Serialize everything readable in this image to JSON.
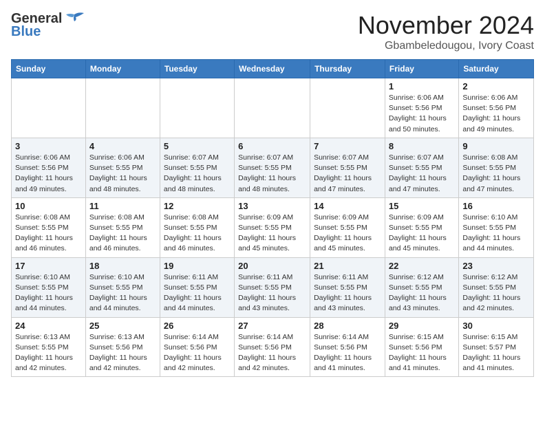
{
  "header": {
    "logo_line1": "General",
    "logo_line2": "Blue",
    "month": "November 2024",
    "location": "Gbambeledougou, Ivory Coast"
  },
  "weekdays": [
    "Sunday",
    "Monday",
    "Tuesday",
    "Wednesday",
    "Thursday",
    "Friday",
    "Saturday"
  ],
  "weeks": [
    [
      {
        "day": "",
        "info": ""
      },
      {
        "day": "",
        "info": ""
      },
      {
        "day": "",
        "info": ""
      },
      {
        "day": "",
        "info": ""
      },
      {
        "day": "",
        "info": ""
      },
      {
        "day": "1",
        "info": "Sunrise: 6:06 AM\nSunset: 5:56 PM\nDaylight: 11 hours\nand 50 minutes."
      },
      {
        "day": "2",
        "info": "Sunrise: 6:06 AM\nSunset: 5:56 PM\nDaylight: 11 hours\nand 49 minutes."
      }
    ],
    [
      {
        "day": "3",
        "info": "Sunrise: 6:06 AM\nSunset: 5:56 PM\nDaylight: 11 hours\nand 49 minutes."
      },
      {
        "day": "4",
        "info": "Sunrise: 6:06 AM\nSunset: 5:55 PM\nDaylight: 11 hours\nand 48 minutes."
      },
      {
        "day": "5",
        "info": "Sunrise: 6:07 AM\nSunset: 5:55 PM\nDaylight: 11 hours\nand 48 minutes."
      },
      {
        "day": "6",
        "info": "Sunrise: 6:07 AM\nSunset: 5:55 PM\nDaylight: 11 hours\nand 48 minutes."
      },
      {
        "day": "7",
        "info": "Sunrise: 6:07 AM\nSunset: 5:55 PM\nDaylight: 11 hours\nand 47 minutes."
      },
      {
        "day": "8",
        "info": "Sunrise: 6:07 AM\nSunset: 5:55 PM\nDaylight: 11 hours\nand 47 minutes."
      },
      {
        "day": "9",
        "info": "Sunrise: 6:08 AM\nSunset: 5:55 PM\nDaylight: 11 hours\nand 47 minutes."
      }
    ],
    [
      {
        "day": "10",
        "info": "Sunrise: 6:08 AM\nSunset: 5:55 PM\nDaylight: 11 hours\nand 46 minutes."
      },
      {
        "day": "11",
        "info": "Sunrise: 6:08 AM\nSunset: 5:55 PM\nDaylight: 11 hours\nand 46 minutes."
      },
      {
        "day": "12",
        "info": "Sunrise: 6:08 AM\nSunset: 5:55 PM\nDaylight: 11 hours\nand 46 minutes."
      },
      {
        "day": "13",
        "info": "Sunrise: 6:09 AM\nSunset: 5:55 PM\nDaylight: 11 hours\nand 45 minutes."
      },
      {
        "day": "14",
        "info": "Sunrise: 6:09 AM\nSunset: 5:55 PM\nDaylight: 11 hours\nand 45 minutes."
      },
      {
        "day": "15",
        "info": "Sunrise: 6:09 AM\nSunset: 5:55 PM\nDaylight: 11 hours\nand 45 minutes."
      },
      {
        "day": "16",
        "info": "Sunrise: 6:10 AM\nSunset: 5:55 PM\nDaylight: 11 hours\nand 44 minutes."
      }
    ],
    [
      {
        "day": "17",
        "info": "Sunrise: 6:10 AM\nSunset: 5:55 PM\nDaylight: 11 hours\nand 44 minutes."
      },
      {
        "day": "18",
        "info": "Sunrise: 6:10 AM\nSunset: 5:55 PM\nDaylight: 11 hours\nand 44 minutes."
      },
      {
        "day": "19",
        "info": "Sunrise: 6:11 AM\nSunset: 5:55 PM\nDaylight: 11 hours\nand 44 minutes."
      },
      {
        "day": "20",
        "info": "Sunrise: 6:11 AM\nSunset: 5:55 PM\nDaylight: 11 hours\nand 43 minutes."
      },
      {
        "day": "21",
        "info": "Sunrise: 6:11 AM\nSunset: 5:55 PM\nDaylight: 11 hours\nand 43 minutes."
      },
      {
        "day": "22",
        "info": "Sunrise: 6:12 AM\nSunset: 5:55 PM\nDaylight: 11 hours\nand 43 minutes."
      },
      {
        "day": "23",
        "info": "Sunrise: 6:12 AM\nSunset: 5:55 PM\nDaylight: 11 hours\nand 42 minutes."
      }
    ],
    [
      {
        "day": "24",
        "info": "Sunrise: 6:13 AM\nSunset: 5:55 PM\nDaylight: 11 hours\nand 42 minutes."
      },
      {
        "day": "25",
        "info": "Sunrise: 6:13 AM\nSunset: 5:56 PM\nDaylight: 11 hours\nand 42 minutes."
      },
      {
        "day": "26",
        "info": "Sunrise: 6:14 AM\nSunset: 5:56 PM\nDaylight: 11 hours\nand 42 minutes."
      },
      {
        "day": "27",
        "info": "Sunrise: 6:14 AM\nSunset: 5:56 PM\nDaylight: 11 hours\nand 42 minutes."
      },
      {
        "day": "28",
        "info": "Sunrise: 6:14 AM\nSunset: 5:56 PM\nDaylight: 11 hours\nand 41 minutes."
      },
      {
        "day": "29",
        "info": "Sunrise: 6:15 AM\nSunset: 5:56 PM\nDaylight: 11 hours\nand 41 minutes."
      },
      {
        "day": "30",
        "info": "Sunrise: 6:15 AM\nSunset: 5:57 PM\nDaylight: 11 hours\nand 41 minutes."
      }
    ]
  ]
}
